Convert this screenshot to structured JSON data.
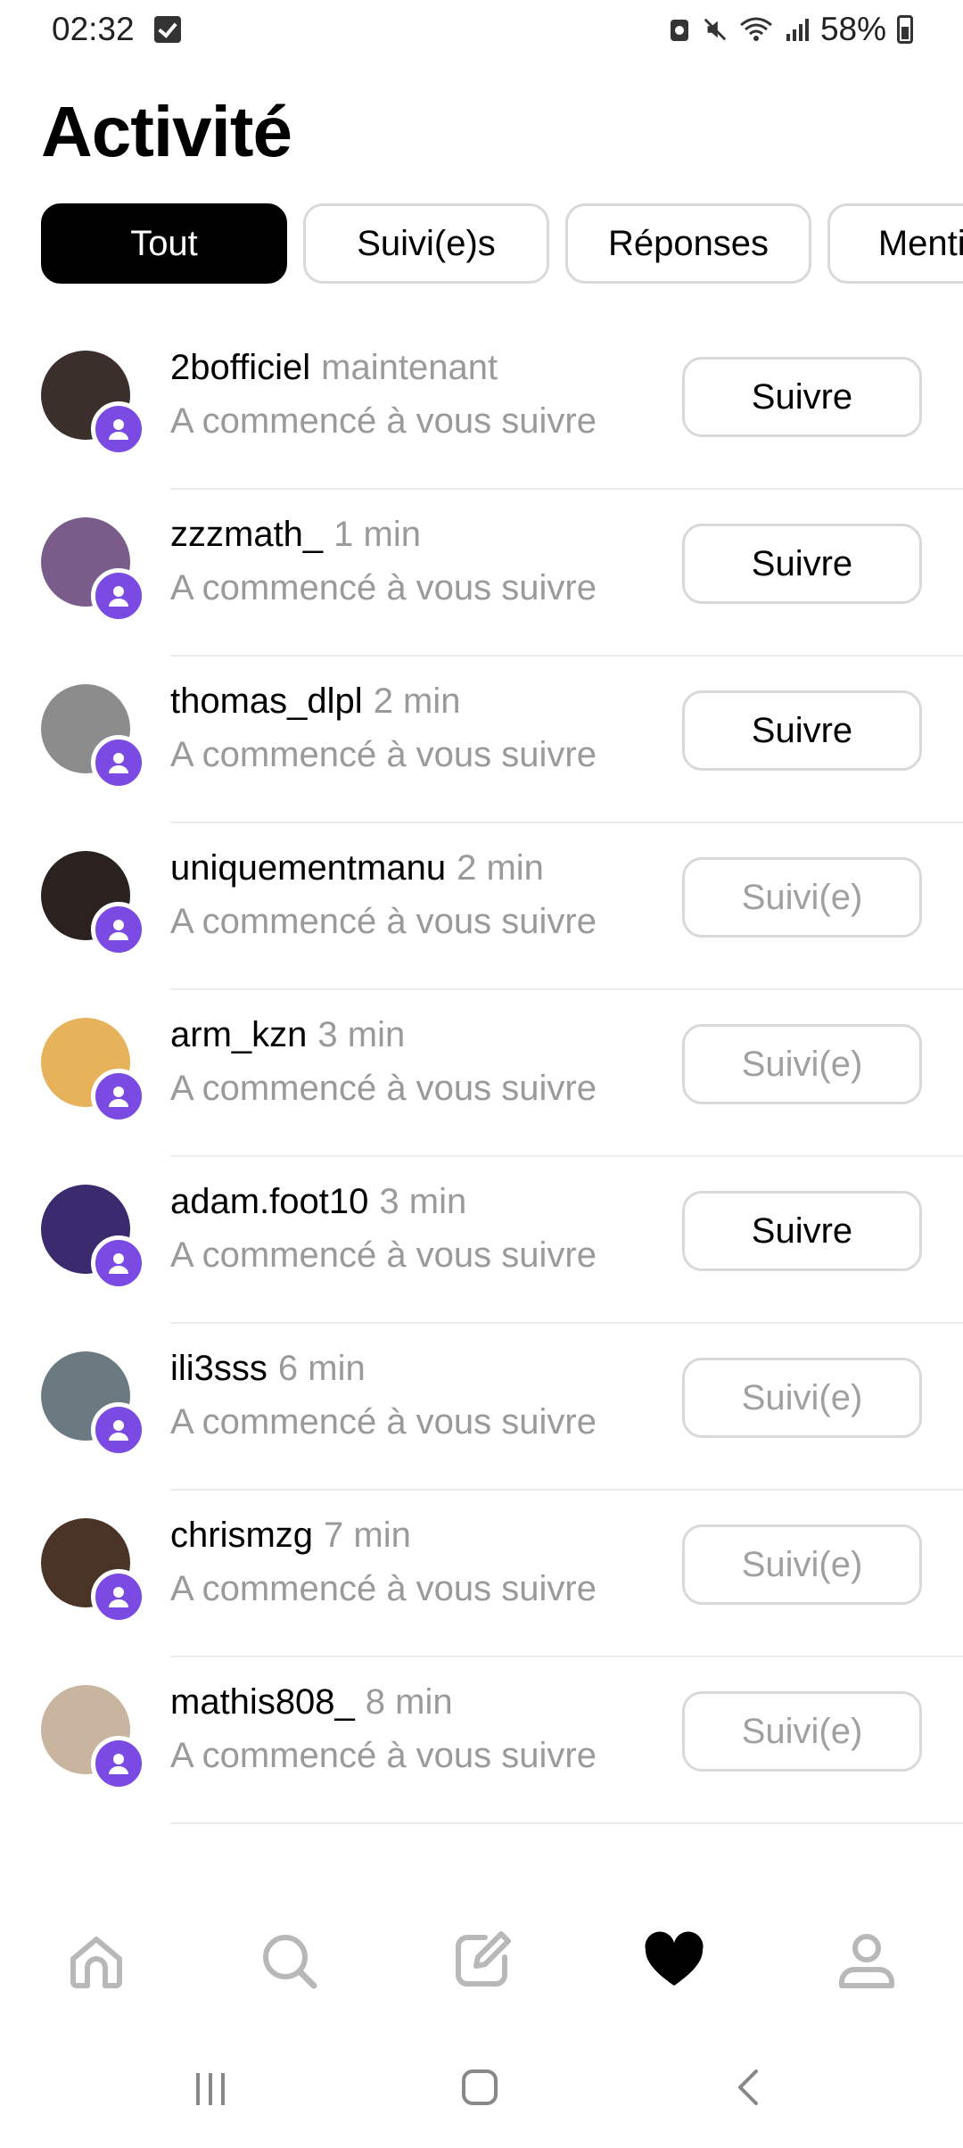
{
  "status_bar": {
    "time": "02:32",
    "battery": "58%"
  },
  "page": {
    "title": "Activité"
  },
  "tabs": [
    {
      "label": "Tout",
      "active": true
    },
    {
      "label": "Suivi(e)s",
      "active": false
    },
    {
      "label": "Réponses",
      "active": false
    },
    {
      "label": "Mentions",
      "active": false
    }
  ],
  "activity": [
    {
      "username": "2bofficiel",
      "time": "maintenant",
      "text": "A commencé à vous suivre",
      "button": "Suivre",
      "following": false,
      "avatar_color": "#3a2f2b"
    },
    {
      "username": "zzzmath_",
      "time": "1 min",
      "text": "A commencé à vous suivre",
      "button": "Suivre",
      "following": false,
      "avatar_color": "#7a5c8a"
    },
    {
      "username": "thomas_dlpl",
      "time": "2 min",
      "text": "A commencé à vous suivre",
      "button": "Suivre",
      "following": false,
      "avatar_color": "#8c8c8c"
    },
    {
      "username": "uniquementmanu",
      "time": "2 min",
      "text": "A commencé à vous suivre",
      "button": "Suivi(e)",
      "following": true,
      "avatar_color": "#2b211e"
    },
    {
      "username": "arm_kzn",
      "time": "3 min",
      "text": "A commencé à vous suivre",
      "button": "Suivi(e)",
      "following": true,
      "avatar_color": "#e6b25a"
    },
    {
      "username": "adam.foot10",
      "time": "3 min",
      "text": "A commencé à vous suivre",
      "button": "Suivre",
      "following": false,
      "avatar_color": "#3b2a6e"
    },
    {
      "username": "ili3sss",
      "time": "6 min",
      "text": "A commencé à vous suivre",
      "button": "Suivi(e)",
      "following": true,
      "avatar_color": "#6b7a80"
    },
    {
      "username": "chrismzg",
      "time": "7 min",
      "text": "A commencé à vous suivre",
      "button": "Suivi(e)",
      "following": true,
      "avatar_color": "#4a3428"
    },
    {
      "username": "mathis808_",
      "time": "8 min",
      "text": "A commencé à vous suivre",
      "button": "Suivi(e)",
      "following": true,
      "avatar_color": "#c9b4a0"
    }
  ],
  "bottom_nav": [
    {
      "icon": "home-icon",
      "active": false
    },
    {
      "icon": "search-icon",
      "active": false
    },
    {
      "icon": "compose-icon",
      "active": false
    },
    {
      "icon": "heart-icon",
      "active": true
    },
    {
      "icon": "profile-icon",
      "active": false
    }
  ],
  "colors": {
    "accent": "#7b4ae2",
    "muted_text": "#9a9a9a",
    "border": "#d9d9d9"
  }
}
